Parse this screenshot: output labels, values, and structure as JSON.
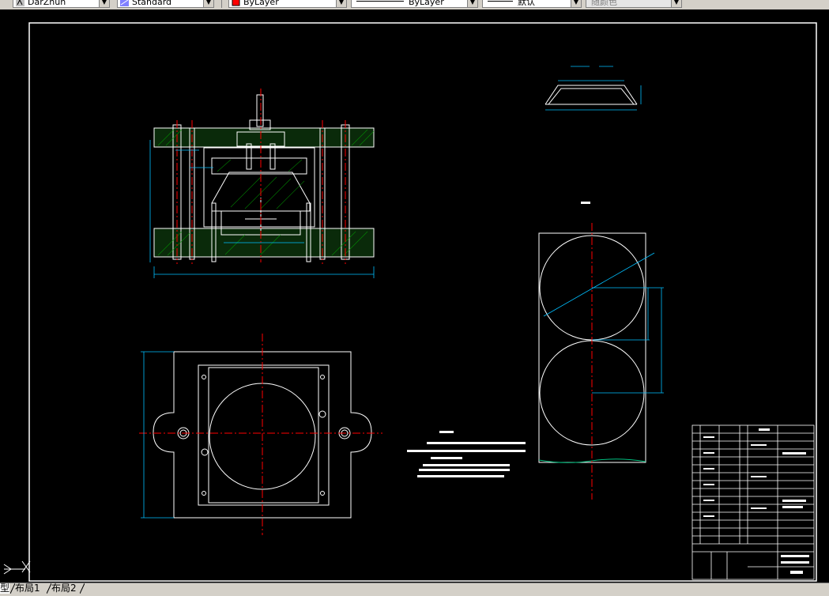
{
  "toolbar": {
    "text_style": "DarZhuh",
    "dim_style": "Standard",
    "layer_color": "ByLayer",
    "linetype": "ByLayer",
    "lineweight": "默认",
    "plot_style": "随颜色"
  },
  "colors": {
    "background": "#000000",
    "geometry": "#ffffff",
    "centerline": "#ff0000",
    "dimension": "#00bfff",
    "hatch": "#00c000",
    "layer_swatch": "#ff0000"
  },
  "layout_tabs": [
    "型",
    "布局1",
    "布局2"
  ],
  "active_tab": 0,
  "icons": [
    "text-style-icon",
    "dim-style-icon",
    "layer-color-swatch-icon",
    "ucs-icon"
  ]
}
